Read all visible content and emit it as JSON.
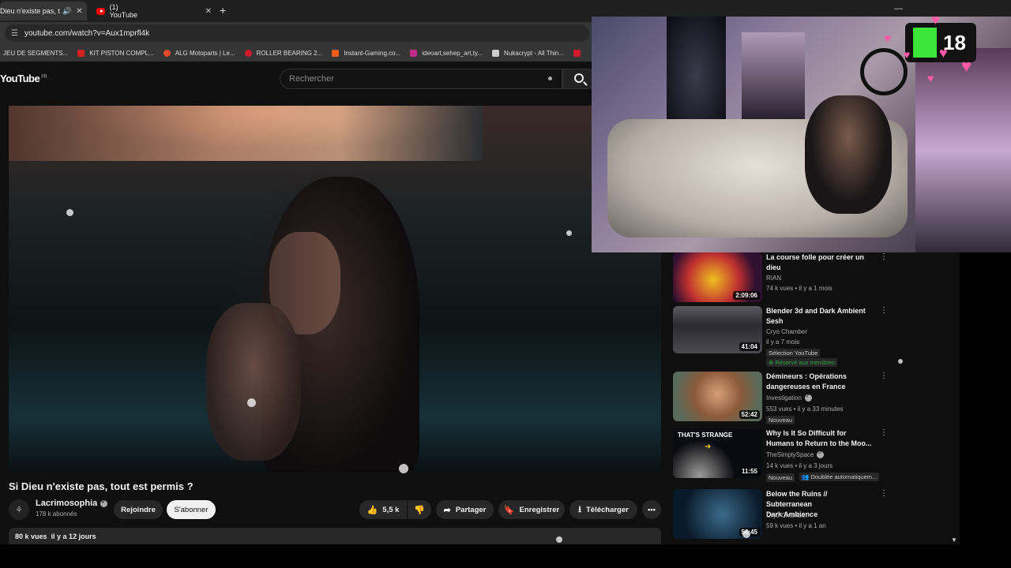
{
  "browser": {
    "tabs": [
      {
        "label": "Dieu n'existe pas, tout",
        "active": true
      },
      {
        "label": "(1) YouTube",
        "active": false
      }
    ],
    "url": "youtube.com/watch?v=Aux1mprfl4k",
    "bookmarks": [
      {
        "label": "JEU DE SEGMENTS...",
        "color": "#353535"
      },
      {
        "label": "KIT PISTON COMPL...",
        "color": "#d32020"
      },
      {
        "label": "ALG Motoparts | Le...",
        "color": "#e04a2a"
      },
      {
        "label": "ROLLER BEARING 2...",
        "color": "#d11a2a"
      },
      {
        "label": "Instant-Gaming.co...",
        "color": "#f05a1a"
      },
      {
        "label": "ideoart,sehep_art,ty...",
        "color": "#c02a8a"
      },
      {
        "label": "Nukacrypt - All Thin...",
        "color": "#cccccc"
      },
      {
        "label": "",
        "color": "#d11a2a"
      }
    ]
  },
  "header": {
    "logo": "YouTube",
    "region": "FR",
    "search_placeholder": "Rechercher"
  },
  "video": {
    "title": "Si Dieu n'existe pas, tout est permis ?",
    "channel": "Lacrimosophia",
    "subscribers": "178 k abonnés",
    "join_label": "Rejoindre",
    "subscribe_label": "S'abonner",
    "likes": "5,5 k",
    "share_label": "Partager",
    "save_label": "Enregistrer",
    "download_label": "Télécharger",
    "views": "80 k vues",
    "date": "il y a 12 jours"
  },
  "recommendations": [
    {
      "title_line1": "La course folle pour créer un",
      "title_line2": "dieu",
      "channel": "RIAN",
      "meta": "74 k vues • il y a 1 mois",
      "duration": "2:09:06"
    },
    {
      "title_line1": "Blender 3d and Dark Ambient",
      "title_line2": "Sesh",
      "channel": "Cryo Chamber",
      "meta": "il y a 7 mois",
      "duration": "41:04",
      "badge1": "Sélection YouTube",
      "badge2": "Réservé aux membres"
    },
    {
      "title_line1": "Démineurs : Opérations",
      "title_line2": "dangereuses en France",
      "channel": "Investigation",
      "meta": "553 vues • il y a 33 minutes",
      "duration": "52:42",
      "badge1": "Nouveau"
    },
    {
      "title_line1": "Why Is It So Difficult for",
      "title_line2": "Humans to Return to the Moo...",
      "channel": "TheSimplySpace",
      "meta": "14 k vues • il y a 3 jours",
      "duration": "11:55",
      "badge1": "Nouveau",
      "badge2": "Doublée automatiquem...",
      "thumb_text": "THAT'S STRANGE"
    },
    {
      "title_line1": "Below the Ruins // Subterranean",
      "title_line2": "Dark Ambience",
      "channel": "Cryo Chamber",
      "meta": "59 k vues • il y a 1 an",
      "duration": "56:45"
    }
  ],
  "overlay": {
    "badge_number": "18"
  }
}
